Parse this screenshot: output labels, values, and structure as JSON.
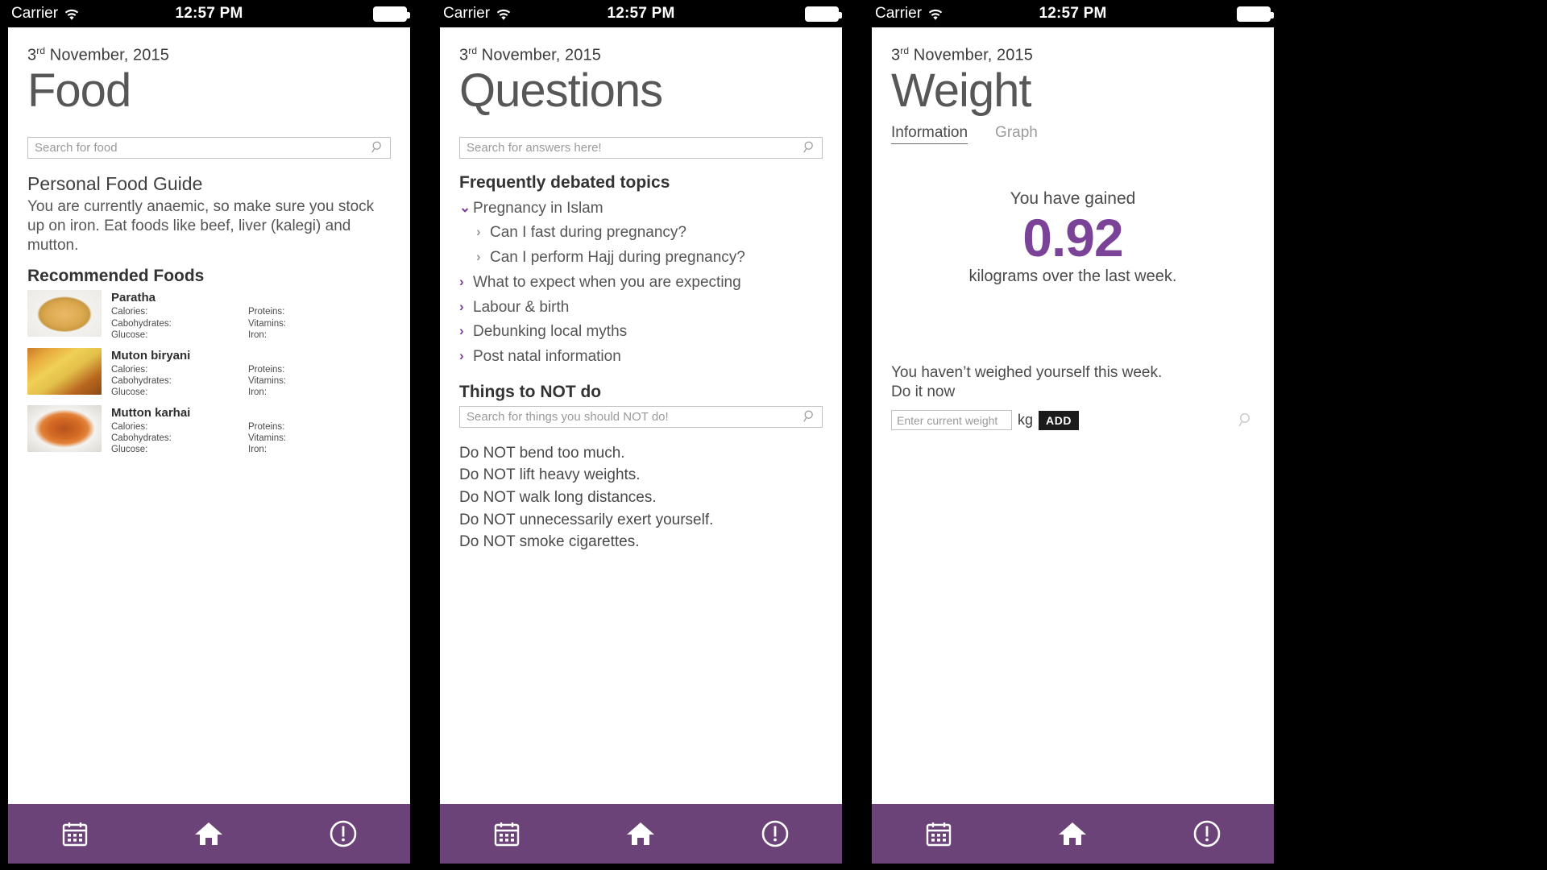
{
  "theme": {
    "accent": "#7b3f98",
    "navbar": "#6c4378",
    "title_gray": "#575757",
    "body_gray": "#555555"
  },
  "status_bar": {
    "carrier": "Carrier",
    "time": "12:57 PM",
    "wifi_icon": "wifi-icon",
    "battery_icon": "battery-full-icon"
  },
  "bottom_nav": {
    "items": [
      {
        "name": "calendar",
        "icon": "calendar-icon"
      },
      {
        "name": "home",
        "icon": "home-icon"
      },
      {
        "name": "alert",
        "icon": "exclamation-circle-icon"
      }
    ]
  },
  "screens": [
    {
      "id": "food",
      "date": {
        "day": "3",
        "ordinal": "rd",
        "rest": "November, 2015"
      },
      "title": "Food",
      "search": {
        "placeholder": "Search for food",
        "icon": "search-icon"
      },
      "guide": {
        "heading": "Personal Food Guide",
        "body": "You are currently anaemic, so make sure you stock up on iron. Eat foods like beef, liver (kalegi) and mutton."
      },
      "recommended_heading": "Recommended Foods",
      "nutrition_labels_left": [
        "Calories:",
        "Cabohydrates:",
        "Glucose:"
      ],
      "nutrition_labels_right": [
        "Proteins:",
        "Vitamins:",
        "Iron:"
      ],
      "foods": [
        {
          "name": "Paratha",
          "image": "paratha-photo"
        },
        {
          "name": "Muton biryani",
          "image": "mutton-biryani-photo"
        },
        {
          "name": "Mutton karhai",
          "image": "mutton-karhai-photo"
        }
      ]
    },
    {
      "id": "questions",
      "date": {
        "day": "3",
        "ordinal": "rd",
        "rest": "November, 2015"
      },
      "title": "Questions",
      "search": {
        "placeholder": "Search for answers here!",
        "icon": "search-icon"
      },
      "topics_heading": "Frequently debated topics",
      "topics": [
        {
          "label": "Pregnancy in Islam",
          "level": 0,
          "expanded": true,
          "chevron": "chevron-down-icon"
        },
        {
          "label": "Can I fast during pregnancy?",
          "level": 1,
          "expanded": false,
          "chevron": "chevron-right-icon"
        },
        {
          "label": "Can I perform Hajj during pregnancy?",
          "level": 1,
          "expanded": false,
          "chevron": "chevron-right-icon"
        },
        {
          "label": "What to expect when you are expecting",
          "level": 0,
          "expanded": false,
          "chevron": "chevron-right-icon"
        },
        {
          "label": "Labour & birth",
          "level": 0,
          "expanded": false,
          "chevron": "chevron-right-icon"
        },
        {
          "label": "Debunking local myths",
          "level": 0,
          "expanded": false,
          "chevron": "chevron-right-icon"
        },
        {
          "label": "Post natal information",
          "level": 0,
          "expanded": false,
          "chevron": "chevron-right-icon"
        }
      ],
      "notdo_heading": "Things to NOT do",
      "notdo_search": {
        "placeholder": "Search for things you should NOT do!",
        "icon": "search-icon"
      },
      "notdo_items": [
        "Do NOT bend too much.",
        "Do NOT lift heavy weights.",
        "Do NOT walk long distances.",
        "Do NOT unnecessarily exert yourself.",
        "Do NOT smoke cigarettes."
      ]
    },
    {
      "id": "weight",
      "date": {
        "day": "3",
        "ordinal": "rd",
        "rest": "November, 2015"
      },
      "title": "Weight",
      "tabs": [
        {
          "label": "Information",
          "active": true
        },
        {
          "label": "Graph",
          "active": false
        }
      ],
      "gain": {
        "lead": "You have gained",
        "value": "0.92",
        "tail": "kilograms over the last week."
      },
      "prompt_line1": "You haven’t weighed yourself this week.",
      "prompt_line2": "Do it now",
      "weight_input": {
        "placeholder": "Enter current weight",
        "value": ""
      },
      "unit": "kg",
      "add_label": "ADD",
      "trailing_icon": "search-icon"
    }
  ]
}
